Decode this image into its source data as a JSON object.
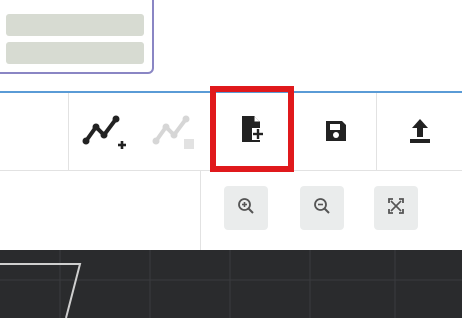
{
  "dropdown": {
    "options": [
      "",
      ""
    ]
  },
  "toolbar": {
    "tools": [
      {
        "name": "add-line-icon",
        "state": "enabled"
      },
      {
        "name": "add-line-disabled-icon",
        "state": "disabled"
      },
      {
        "name": "add-file-icon",
        "state": "highlighted"
      },
      {
        "name": "save-icon",
        "state": "enabled"
      },
      {
        "name": "upload-icon",
        "state": "enabled"
      }
    ],
    "highlight_color": "#e0191c",
    "accent_color": "#5a9bd6"
  },
  "zoom": {
    "buttons": [
      {
        "name": "zoom-in-icon"
      },
      {
        "name": "zoom-out-icon"
      },
      {
        "name": "fit-to-screen-icon"
      }
    ]
  },
  "canvas": {
    "background": "#2a2b2d"
  }
}
